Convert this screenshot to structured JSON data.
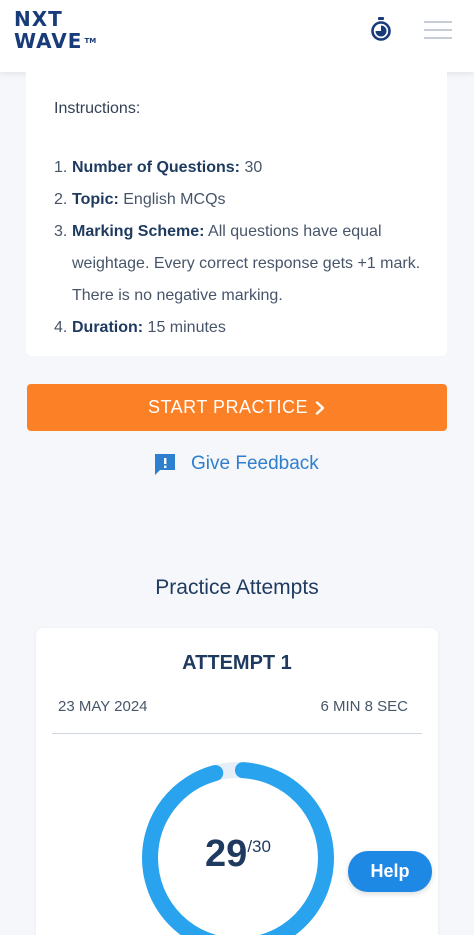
{
  "header": {
    "logo_line1": "NXT",
    "logo_line2": "WAVE",
    "logo_tm": "TM",
    "timer_icon": "stopwatch-icon",
    "menu_icon": "hamburger-menu-icon"
  },
  "instructions": {
    "title": "Instructions:",
    "items": [
      {
        "num": "1.",
        "label": "Number of Questions:",
        "text": " 30"
      },
      {
        "num": "2.",
        "label": "Topic:",
        "text": " English MCQs"
      },
      {
        "num": "3.",
        "label": "Marking Scheme:",
        "text": " All questions have equal weightage. Every correct response gets +1 mark. There is no negative marking."
      },
      {
        "num": "4.",
        "label": " Duration:",
        "text": "  15 minutes"
      }
    ]
  },
  "start_button": {
    "label": "START PRACTICE",
    "icon": "chevron-right-icon"
  },
  "feedback": {
    "label": "Give Feedback",
    "icon": "feedback-chat-icon"
  },
  "attempts": {
    "title": "Practice Attempts",
    "items": [
      {
        "title": "ATTEMPT 1",
        "date": "23 MAY 2024",
        "duration": "6 MIN 8 SEC",
        "score": "29",
        "total": "/30",
        "score_fraction": 0.967
      }
    ]
  },
  "help_button": {
    "label": "Help"
  },
  "colors": {
    "brand": "#183b7a",
    "accent_orange": "#fb8026",
    "link_blue": "#2f7fcf",
    "ring_blue": "#29a3ee",
    "help_blue": "#1e88e5"
  }
}
